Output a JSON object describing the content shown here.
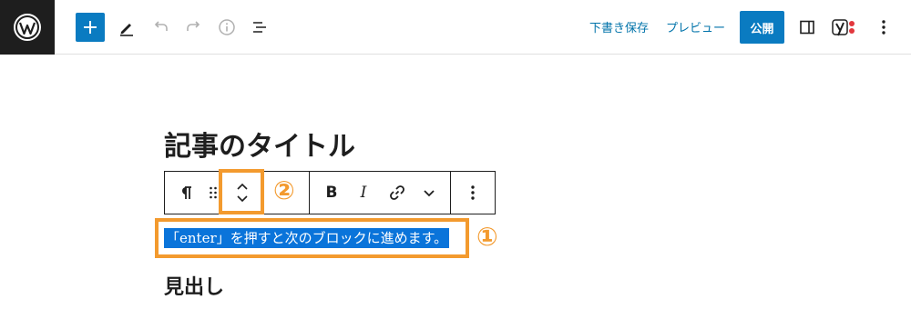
{
  "topbar": {
    "save_draft_label": "下書き保存",
    "preview_label": "プレビュー",
    "publish_label": "公開"
  },
  "editor": {
    "post_title": "記事のタイトル",
    "selected_paragraph": "「enter」を押すと次のブロックに進めます。",
    "heading_text": "見出し"
  },
  "block_toolbar": {
    "bold_label": "B",
    "italic_label": "I"
  },
  "annotations": {
    "marker_1": "①",
    "marker_2": "②"
  },
  "colors": {
    "accent": "#0a7bc1",
    "annotation": "#f39a2e",
    "selection": "#0a74da",
    "yoast_dot": "#e2373d"
  },
  "icons": [
    "wordpress-logo-icon",
    "plus-icon",
    "pencil-icon",
    "undo-icon",
    "redo-icon",
    "info-icon",
    "list-view-icon",
    "sidebar-toggle-icon",
    "yoast-icon",
    "more-vertical-icon",
    "pilcrow-icon",
    "drag-handle-icon",
    "chevron-up-icon",
    "chevron-down-icon",
    "link-icon"
  ]
}
